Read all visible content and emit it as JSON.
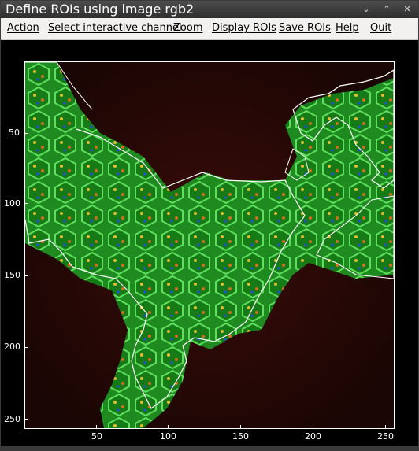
{
  "window": {
    "title": "Define ROIs using image rgb2",
    "controls": [
      "minimize",
      "maximize",
      "close"
    ]
  },
  "menu": {
    "items": [
      {
        "label": "Action"
      },
      {
        "label": "Select interactive channel"
      },
      {
        "label": "Zoom"
      },
      {
        "label": "Display ROIs"
      },
      {
        "label": "Save ROIs"
      },
      {
        "label": "Help"
      },
      {
        "label": "Quit"
      }
    ]
  },
  "image": {
    "description_colors": {
      "background": "#2a0a06",
      "tissue": "#2aa02a",
      "roi_outline": "#ffffff"
    },
    "y_ticks": [
      "50",
      "100",
      "150",
      "200",
      "250"
    ],
    "x_ticks": [
      "50",
      "100",
      "150",
      "200",
      "250"
    ]
  }
}
